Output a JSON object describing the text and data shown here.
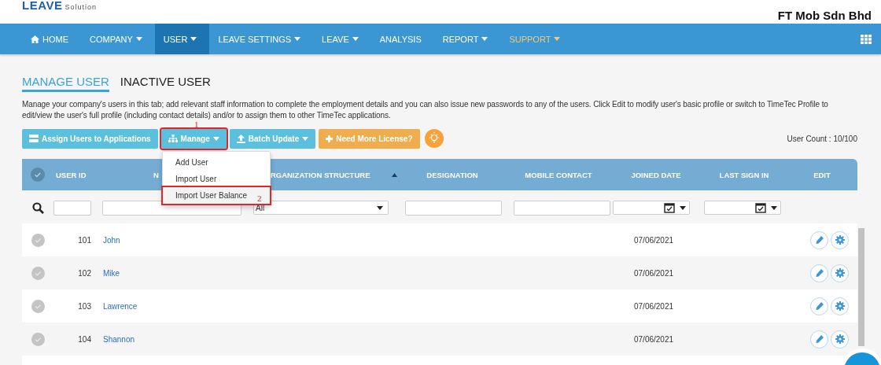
{
  "header": {
    "logo": {
      "brand": "LEAVE",
      "tagline": "Solution"
    },
    "company": "FT Mob Sdn Bhd"
  },
  "nav": [
    {
      "label": "HOME",
      "kind": "home",
      "selected": false,
      "highlighted": false,
      "caret": false
    },
    {
      "label": "COMPANY",
      "kind": "menu",
      "selected": false,
      "highlighted": false,
      "caret": true
    },
    {
      "label": "USER",
      "kind": "menu",
      "selected": true,
      "highlighted": false,
      "caret": true
    },
    {
      "label": "LEAVE SETTINGS",
      "kind": "menu",
      "selected": false,
      "highlighted": false,
      "caret": true
    },
    {
      "label": "LEAVE",
      "kind": "menu",
      "selected": false,
      "highlighted": false,
      "caret": true
    },
    {
      "label": "ANALYSIS",
      "kind": "menu",
      "selected": false,
      "highlighted": false,
      "caret": false
    },
    {
      "label": "REPORT",
      "kind": "menu",
      "selected": false,
      "highlighted": false,
      "caret": true
    },
    {
      "label": "SUPPORT",
      "kind": "menu",
      "selected": false,
      "highlighted": true,
      "caret": true
    }
  ],
  "tabs": [
    {
      "label": "MANAGE USER",
      "selected": true
    },
    {
      "label": "INACTIVE USER",
      "selected": false
    }
  ],
  "description": "Manage your company's users in this tab; add relevant staff information to complete the employment details and you can also issue new passwords to any of the users. Click Edit to modify user's basic profile or switch to TimeTec Profile to edit/view the user's full profile (including contact details) and/or to assign them to other TimeTec applications.",
  "toolbar": [
    {
      "label": "Assign Users to Applications",
      "kind": "assign",
      "caret": false,
      "annotated": false
    },
    {
      "label": "Manage",
      "kind": "manage",
      "caret": true,
      "annotated": true
    },
    {
      "label": "Batch Update",
      "kind": "upload",
      "caret": true,
      "annotated": false
    },
    {
      "label": "Need More License?",
      "kind": "license",
      "caret": false,
      "annotated": false
    }
  ],
  "user_count": "User Count : 10/100",
  "manage_menu": [
    {
      "label": "Add User",
      "annotated": false
    },
    {
      "label": "Import User",
      "annotated": false
    },
    {
      "label": "Import User Balance",
      "annotated": true
    }
  ],
  "annotations": [
    "1",
    "2"
  ],
  "table": {
    "columns": [
      "USER ID",
      "N",
      "RGANIZATION STRUCTURE",
      "DESIGNATION",
      "MOBILE CONTACT",
      "JOINED DATE",
      "LAST SIGN IN",
      "EDIT"
    ],
    "org_filter": "All",
    "rows": [
      {
        "id": "101",
        "name": "John",
        "joined": "07/06/2021",
        "selected": false
      },
      {
        "id": "102",
        "name": "Mike",
        "joined": "07/06/2021",
        "selected": false
      },
      {
        "id": "103",
        "name": "Lawrence",
        "joined": "07/06/2021",
        "selected": false
      },
      {
        "id": "104",
        "name": "Shannon",
        "joined": "07/06/2021",
        "selected": false
      }
    ]
  }
}
